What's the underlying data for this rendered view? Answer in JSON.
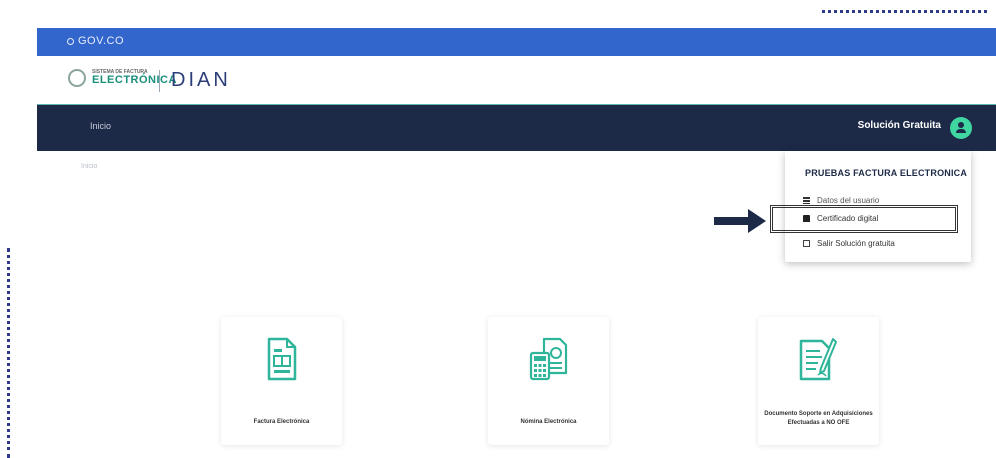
{
  "gov_bar": {
    "logo_text": "GOV.CO"
  },
  "brand": {
    "fe_small": "SISTEMA DE FACTURA",
    "fe_big": "ELECTRÓNICA",
    "dian": "DIAN"
  },
  "nav": {
    "inicio": "Inicio",
    "user_label": "Solución Gratuita",
    "avatar_icon": "user-icon"
  },
  "breadcrumb": "Inicio",
  "dropdown": {
    "title": "PRUEBAS FACTURA ELECTRONICA",
    "items": [
      {
        "label": "Datos del usuario",
        "icon": "list-icon"
      },
      {
        "label": "Certificado digital",
        "icon": "lock-icon"
      },
      {
        "label": "Salir Solución gratuita",
        "icon": "exit-icon"
      }
    ]
  },
  "cards": [
    {
      "label": "Factura Electrónica",
      "icon": "invoice-icon"
    },
    {
      "label": "Nómina Electrónica",
      "icon": "payroll-calculator-icon"
    },
    {
      "label": "Documento Soporte en Adquisiciones Efectuadas a NO OFE",
      "icon": "document-pen-icon"
    }
  ],
  "colors": {
    "gov_blue": "#3366cc",
    "nav_dark": "#1c2a47",
    "accent_green": "#3fd6a2",
    "icon_teal": "#2fb59a"
  }
}
